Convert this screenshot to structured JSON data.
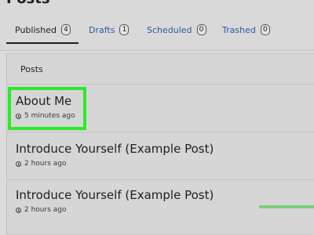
{
  "header": {
    "page_title": "Posts"
  },
  "tabs": [
    {
      "label": "Published",
      "count": "4",
      "active": true
    },
    {
      "label": "Drafts",
      "count": "1",
      "active": false
    },
    {
      "label": "Scheduled",
      "count": "0",
      "active": false
    },
    {
      "label": "Trashed",
      "count": "0",
      "active": false
    }
  ],
  "list": {
    "header_label": "Posts",
    "posts": [
      {
        "title": "About Me",
        "meta": "5 minutes ago",
        "highlighted": true
      },
      {
        "title": "Introduce Yourself (Example Post)",
        "meta": "2 hours ago"
      },
      {
        "title": "Introduce Yourself (Example Post)",
        "meta": "2 hours ago"
      }
    ]
  },
  "colors": {
    "highlight": "#2de82d",
    "link": "#2c5aa0",
    "background": "#dcdcdc"
  },
  "icons": {
    "post_meta": "clock-icon"
  }
}
